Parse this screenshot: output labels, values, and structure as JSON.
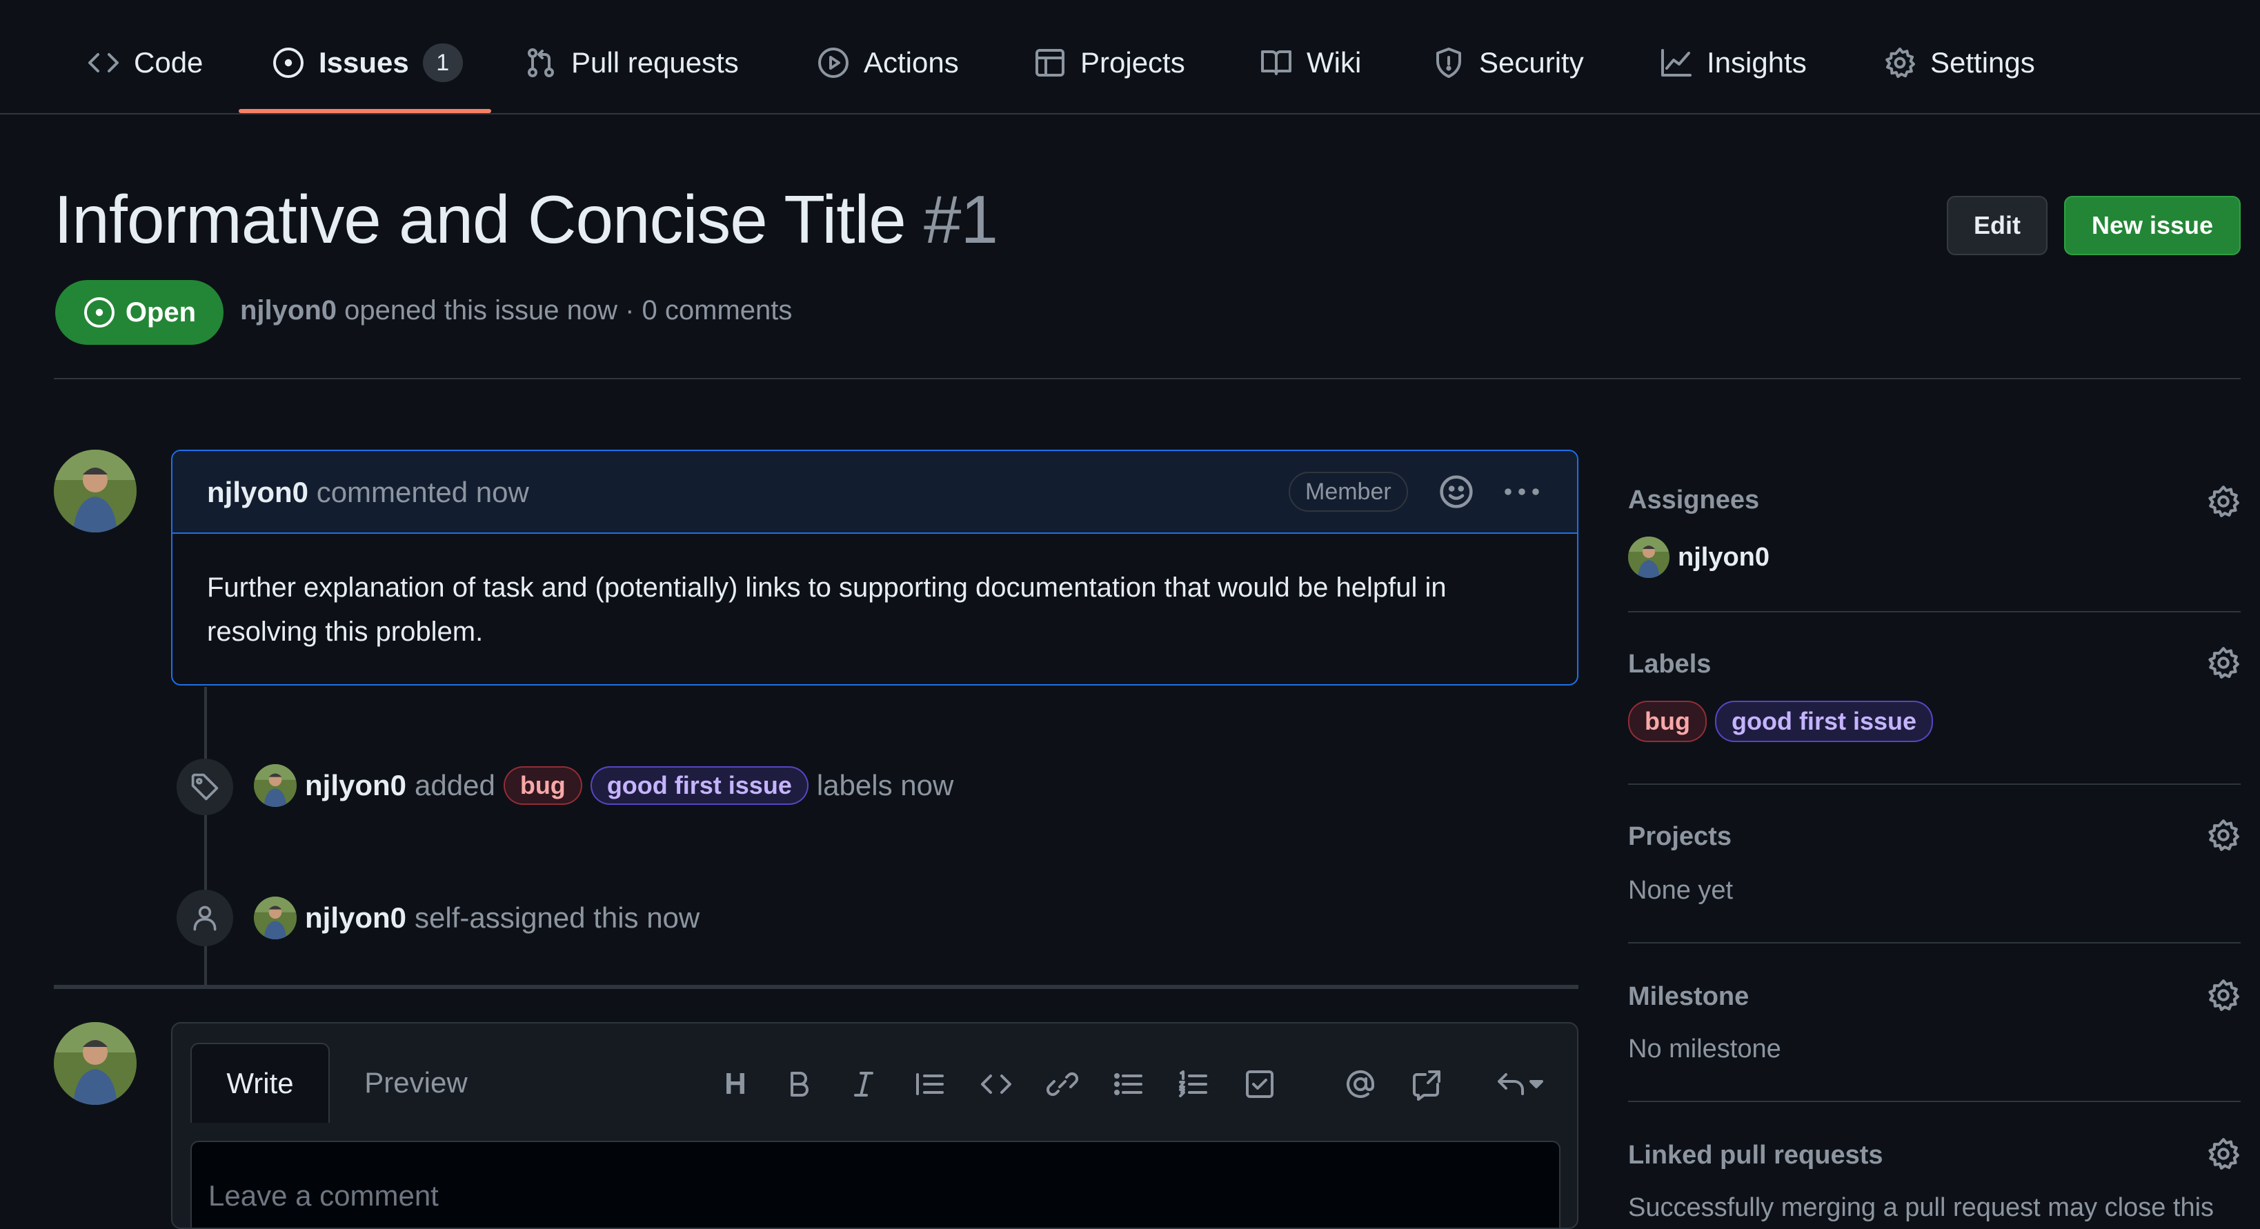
{
  "nav": {
    "tabs": [
      {
        "label": "Code",
        "icon": "code-icon"
      },
      {
        "label": "Issues",
        "icon": "issue-icon",
        "count": "1",
        "active": true
      },
      {
        "label": "Pull requests",
        "icon": "pull-request-icon"
      },
      {
        "label": "Actions",
        "icon": "play-icon"
      },
      {
        "label": "Projects",
        "icon": "table-icon"
      },
      {
        "label": "Wiki",
        "icon": "book-icon"
      },
      {
        "label": "Security",
        "icon": "shield-icon"
      },
      {
        "label": "Insights",
        "icon": "graph-icon"
      },
      {
        "label": "Settings",
        "icon": "gear-icon"
      }
    ]
  },
  "issue": {
    "title": "Informative and Concise Title",
    "number": "#1",
    "state": "Open",
    "author": "njlyon0",
    "meta_text": "opened this issue now · 0 comments"
  },
  "header": {
    "edit_label": "Edit",
    "new_issue_label": "New issue"
  },
  "comment": {
    "author": "njlyon0",
    "action": "commented now",
    "badge": "Member",
    "body": "Further explanation of task and (potentially) links to supporting documentation that would be helpful in resolving this problem."
  },
  "timeline": {
    "labels_event": {
      "actor": "njlyon0",
      "verb": "added",
      "labels": [
        "bug",
        "good first issue"
      ],
      "suffix": "labels now"
    },
    "assign_event": {
      "actor": "njlyon0",
      "text": "self-assigned this now"
    }
  },
  "composer": {
    "write_tab": "Write",
    "preview_tab": "Preview",
    "heading_glyph": "H",
    "placeholder": "Leave a comment"
  },
  "sidebar": {
    "assignees": {
      "heading": "Assignees",
      "user": "njlyon0"
    },
    "labels": {
      "heading": "Labels",
      "items": [
        "bug",
        "good first issue"
      ]
    },
    "projects": {
      "heading": "Projects",
      "value": "None yet"
    },
    "milestone": {
      "heading": "Milestone",
      "value": "No milestone"
    },
    "linked_prs": {
      "heading": "Linked pull requests",
      "value": "Successfully merging a pull request may close this"
    }
  },
  "colors": {
    "background": "#0d1117",
    "accent_underline": "#f78166",
    "open_green": "#238636",
    "comment_border": "#1f6feb",
    "label_bug": "#d73a4a",
    "label_good_first_issue": "#7057ff"
  }
}
